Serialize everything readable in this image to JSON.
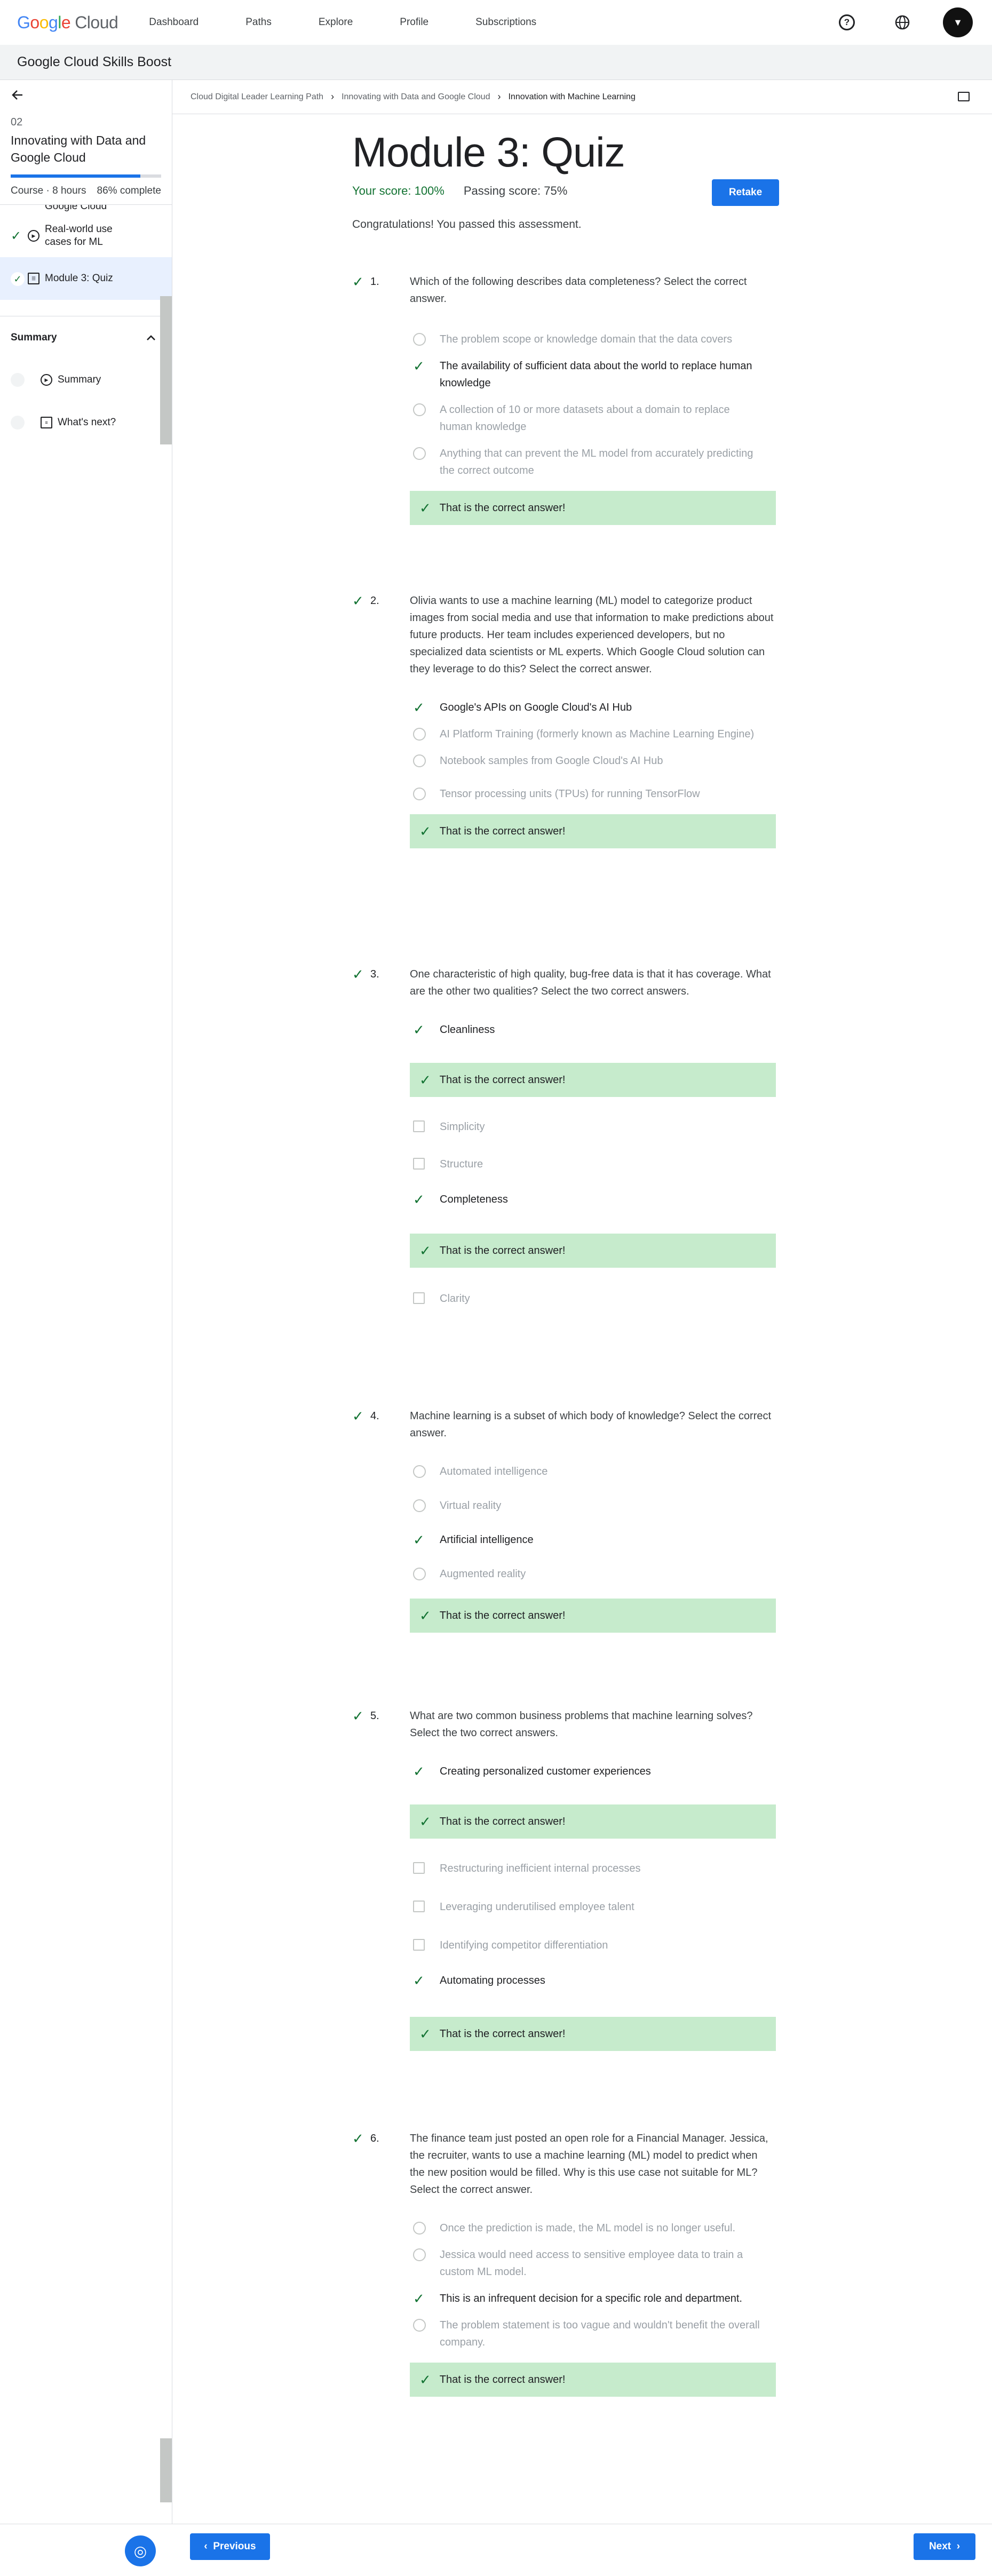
{
  "nav": {
    "logo_google": "Google",
    "logo_cloud": "Cloud",
    "links": [
      "Dashboard",
      "Paths",
      "Explore",
      "Profile",
      "Subscriptions"
    ],
    "avatar_letter": "▼"
  },
  "subbar": {
    "title": "Google Cloud Skills Boost"
  },
  "sidebar": {
    "course_number": "02",
    "course_title": "Innovating with Data and Google Cloud",
    "progress": 0.86,
    "meta_type": "Course · 8 hours",
    "meta_complete": "86% complete",
    "items": [
      {
        "label": "Google Cloud",
        "state": "partial"
      },
      {
        "label": "Real-world use cases for ML",
        "state": "complete"
      },
      {
        "label": "Module 3: Quiz",
        "state": "complete-active"
      }
    ],
    "section_title": "Summary",
    "section_items": [
      {
        "label": "Summary"
      },
      {
        "label": "What's next?"
      }
    ]
  },
  "breadcrumb": {
    "items": [
      "Cloud Digital Leader Learning Path",
      "Innovating with Data and Google Cloud",
      "Innovation with Machine Learning"
    ]
  },
  "quiz": {
    "title": "Module 3: Quiz",
    "score_label": "Your score: 100%",
    "passing_label": "Passing score: 75%",
    "retake_label": "Retake",
    "congrats": "Congratulations! You passed this assessment.",
    "feedback_correct": "That is the correct answer!",
    "questions": [
      {
        "num": "1.",
        "text": "Which of the following describes data completeness? Select the correct answer.",
        "options": [
          "The problem scope or knowledge domain that the data covers",
          "The availability of sufficient data about the world to replace human knowledge",
          "A collection of 10 or more datasets about a domain to replace human knowledge",
          "Anything that can prevent the ML model from accurately predicting the correct outcome"
        ]
      },
      {
        "num": "2.",
        "text": "Olivia wants to use a machine learning (ML) model to categorize product images from social media and use that information to make predictions about future products. Her team includes experienced developers, but no specialized data scientists or ML experts. Which Google Cloud solution can they leverage to do this? Select the correct answer.",
        "options": [
          "Google's APIs on Google Cloud's AI Hub",
          "AI Platform Training (formerly known as Machine Learning Engine)",
          "Notebook samples from Google Cloud's AI Hub",
          "Tensor processing units (TPUs) for running TensorFlow"
        ]
      },
      {
        "num": "3.",
        "text": "One characteristic of high quality, bug-free data is that it has coverage. What are the other two qualities? Select the two correct answers.",
        "options": [
          "Cleanliness",
          "Simplicity",
          "Structure",
          "Completeness",
          "Clarity"
        ]
      },
      {
        "num": "4.",
        "text": "Machine learning is a subset of which body of knowledge? Select the correct answer.",
        "options": [
          "Automated intelligence",
          "Virtual reality",
          "Artificial intelligence",
          "Augmented reality"
        ]
      },
      {
        "num": "5.",
        "text": "What are two common business problems that machine learning solves? Select the two correct answers.",
        "options": [
          "Creating personalized customer experiences",
          "Restructuring inefficient internal processes",
          "Leveraging underutilised employee talent",
          "Identifying competitor differentiation",
          "Automating processes"
        ]
      },
      {
        "num": "6.",
        "text": "The finance team just posted an open role for a Financial Manager. Jessica, the recruiter, wants to use a machine learning (ML) model to predict when the new position would be filled. Why is this use case not suitable for ML? Select the correct answer.",
        "options": [
          "Once the prediction is made, the ML model is no longer useful.",
          "Jessica would need access to sensitive employee data to train a custom ML model.",
          "This is an infrequent decision for a specific role and department.",
          "The problem statement is too vague and wouldn't benefit the overall company."
        ]
      }
    ]
  },
  "footer": {
    "previous_label": "Previous",
    "next_label": "Next"
  },
  "colors": {
    "accent": "#1a73e8",
    "correct": "#137333",
    "feedback_bg": "#c6ebcc"
  }
}
